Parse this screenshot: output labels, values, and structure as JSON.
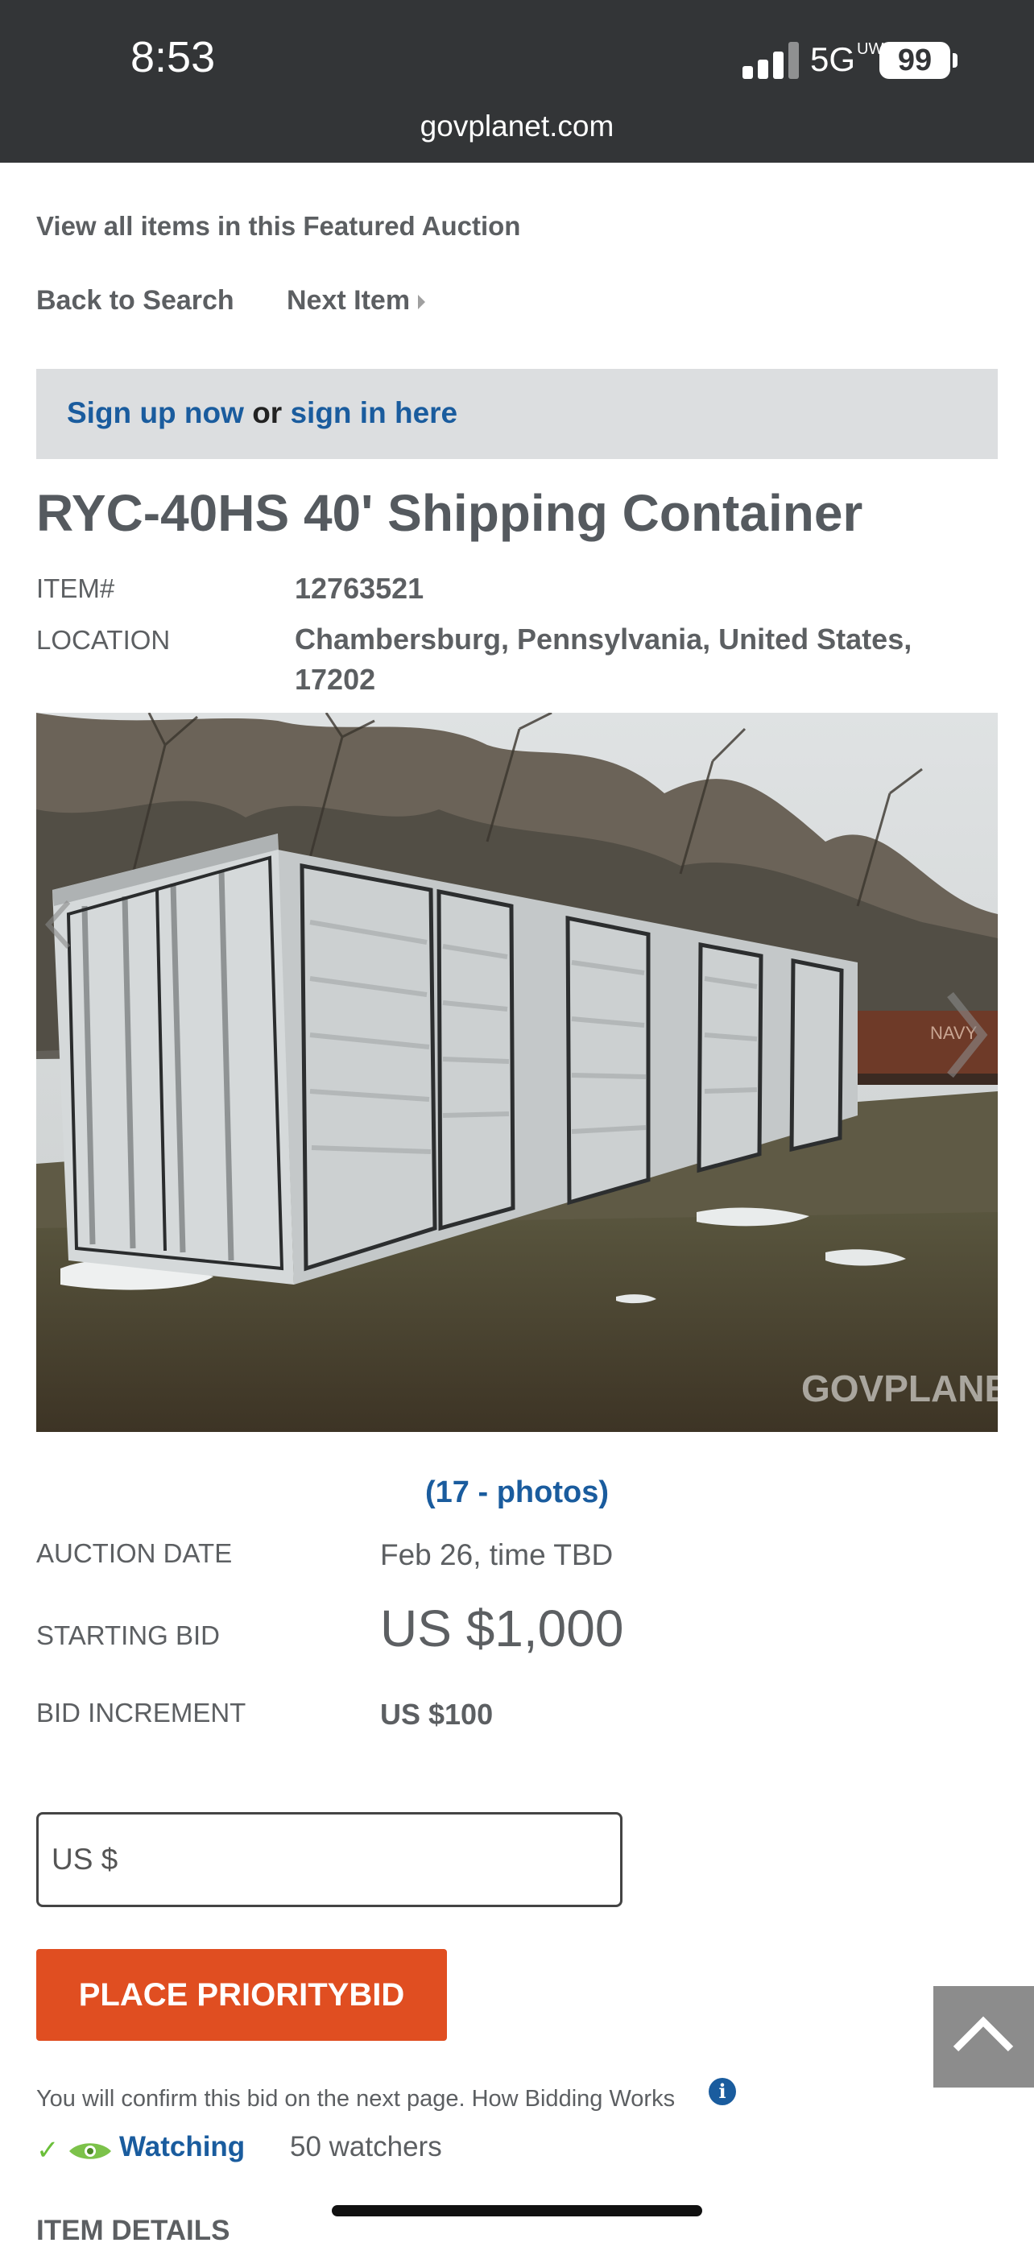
{
  "status_bar": {
    "time": "8:53",
    "network": "5G",
    "network_suffix": "UW",
    "battery": "99",
    "url": "govplanet.com"
  },
  "nav": {
    "featured_link": "View all items in this Featured Auction",
    "back_label": "Back to Search",
    "next_label": "Next Item"
  },
  "signup": {
    "signup_link": "Sign up now",
    "or_text": "or",
    "signin_link": "sign in here"
  },
  "item": {
    "title": "RYC-40HS 40' Shipping Container",
    "item_label": "ITEM#",
    "item_number": "12763521",
    "location_label": "LOCATION",
    "location_line1": "Chambersburg, Pennsylvania, United States,",
    "location_line2": "17202"
  },
  "photo": {
    "watermark": "GOVPLANET",
    "container_marking": "NAVY",
    "photos_link": "(17 - photos)"
  },
  "auction": {
    "date_label": "AUCTION DATE",
    "date_value": "Feb 26, time TBD",
    "start_label": "STARTING BID",
    "start_value": "US $1,000",
    "increment_label": "BID INCREMENT",
    "increment_value": "US $100"
  },
  "bid": {
    "input_placeholder": "US $",
    "button_label": "PLACE PRIORITYBID",
    "confirm_text": "You will confirm this bid on the next page. How Bidding Works"
  },
  "watch": {
    "watching_label": "Watching",
    "watchers": "50 watchers"
  },
  "section": {
    "details_heading": "ITEM DETAILS"
  },
  "icons": {
    "accent": "#1a5c9e",
    "button_color": "#e04e21"
  }
}
